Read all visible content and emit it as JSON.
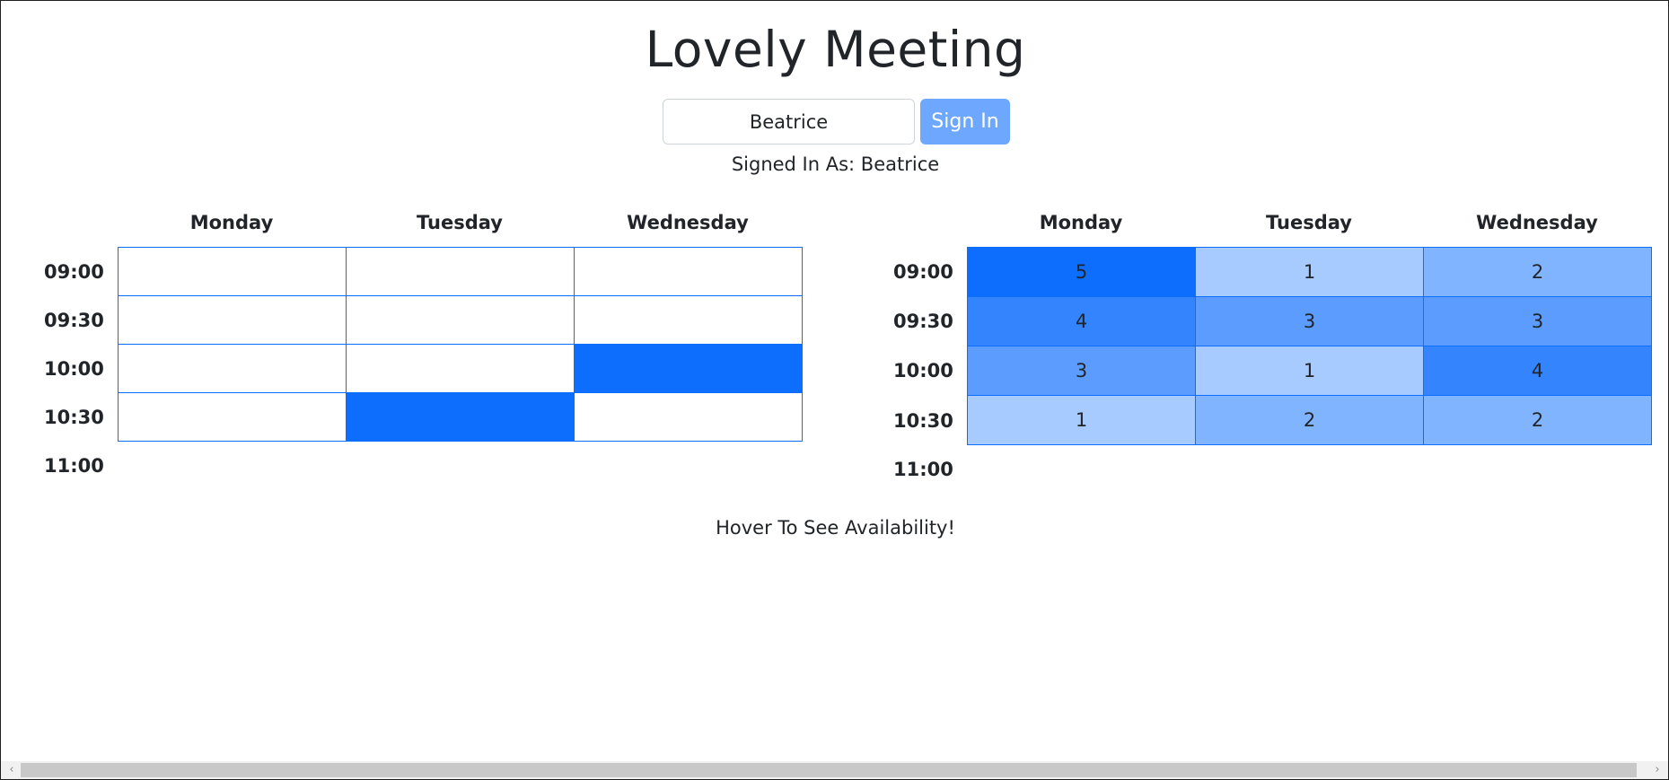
{
  "title": "Lovely Meeting",
  "signin": {
    "name_value": "Beatrice",
    "button_label": "Sign In",
    "status_text": "Signed In As: Beatrice"
  },
  "days": [
    "Monday",
    "Tuesday",
    "Wednesday"
  ],
  "times": [
    "09:00",
    "09:30",
    "10:00",
    "10:30",
    "11:00"
  ],
  "my_availability": [
    [
      false,
      false,
      false
    ],
    [
      false,
      false,
      false
    ],
    [
      false,
      false,
      true
    ],
    [
      false,
      true,
      false
    ]
  ],
  "group_availability": [
    [
      "5",
      "1",
      "2"
    ],
    [
      "4",
      "3",
      "3"
    ],
    [
      "3",
      "1",
      "4"
    ],
    [
      "1",
      "2",
      "2"
    ]
  ],
  "group_max": 5,
  "hint": "Hover To See Availability!",
  "colors": {
    "accent": "#0d6efd",
    "button": "#6ea8fe"
  },
  "icons": {
    "scroll_left": "chevron-left-icon",
    "scroll_right": "chevron-right-icon"
  }
}
